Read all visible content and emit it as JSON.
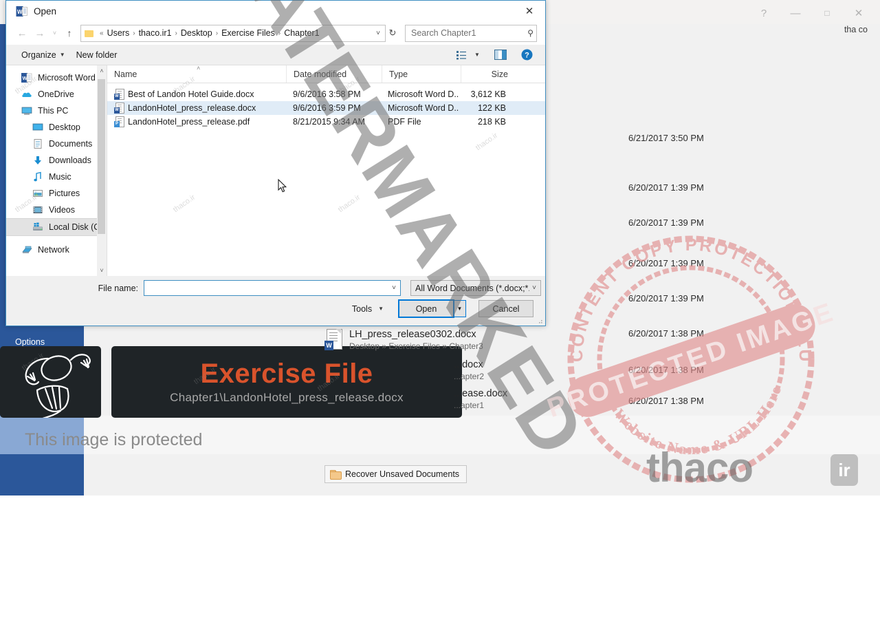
{
  "word_app": {
    "account_name": "tha co",
    "window_buttons": [
      {
        "name": "help",
        "glyph": "?"
      },
      {
        "name": "minimize",
        "glyph": "—"
      },
      {
        "name": "restore",
        "glyph": "□"
      },
      {
        "name": "close",
        "glyph": "✕"
      }
    ],
    "options_label": "Options",
    "exercise_banner": {
      "title": "Exercise File",
      "subtitle": "Chapter1\\LandonHotel_press_release.docx"
    },
    "protected_message": "This image is protected",
    "recover_button": "Recover Unsaved Documents",
    "recent_documents": [
      {
        "name": "LH_press_release0302.docx",
        "path": "Desktop » Exercise Files » Chapter3",
        "date": "6/21/2017 3:50 PM"
      },
      {
        "name": "...docx",
        "path": "...apter2",
        "date": "6/20/2017 1:39 PM"
      },
      {
        "name": "...ease.docx",
        "path": "...apter1",
        "date": "6/20/2017 1:39 PM"
      }
    ],
    "recent_dates": [
      "6/21/2017 3:50 PM",
      "6/20/2017 1:39 PM",
      "6/20/2017 1:39 PM",
      "6/20/2017 1:39 PM",
      "6/20/2017 1:39 PM",
      "6/20/2017 1:38 PM",
      "6/20/2017 1:38 PM",
      "6/20/2017 1:38 PM"
    ]
  },
  "dialog": {
    "title": "Open",
    "close_glyph": "✕",
    "nav": {
      "back_glyph": "←",
      "forward_glyph": "→",
      "history_glyph": "˅",
      "up_glyph": "↑",
      "refresh_glyph": "↻",
      "dropdown_glyph": "˅"
    },
    "breadcrumb": {
      "prefix": "«",
      "items": [
        "Users",
        "thaco.ir1",
        "Desktop",
        "Exercise Files",
        "Chapter1"
      ],
      "separator": "›"
    },
    "search": {
      "placeholder": "Search Chapter1",
      "icon": "search-icon",
      "glyph": "⚲"
    },
    "toolbar": {
      "organize": "Organize",
      "new_folder": "New folder",
      "caret": "▼",
      "view_icon": "view-list-icon",
      "preview_icon": "preview-pane-icon",
      "help_icon": "help-icon",
      "help_glyph": "?"
    },
    "nav_pane": {
      "items": [
        {
          "label": "Microsoft Word",
          "icon": "word-icon",
          "indent": false,
          "selected": false
        },
        {
          "label": "OneDrive",
          "icon": "onedrive-cloud-icon",
          "indent": false,
          "selected": false
        },
        {
          "label": "This PC",
          "icon": "this-pc-icon",
          "indent": false,
          "selected": false
        },
        {
          "label": "Desktop",
          "icon": "desktop-icon",
          "indent": true,
          "selected": false
        },
        {
          "label": "Documents",
          "icon": "documents-icon",
          "indent": true,
          "selected": false
        },
        {
          "label": "Downloads",
          "icon": "downloads-icon",
          "indent": true,
          "selected": false
        },
        {
          "label": "Music",
          "icon": "music-note-icon",
          "indent": true,
          "selected": false
        },
        {
          "label": "Pictures",
          "icon": "pictures-icon",
          "indent": true,
          "selected": false
        },
        {
          "label": "Videos",
          "icon": "videos-icon",
          "indent": true,
          "selected": false
        },
        {
          "label": "Local Disk (C:)",
          "icon": "hard-drive-icon",
          "indent": true,
          "selected": true
        },
        {
          "label": "Network",
          "icon": "network-icon",
          "indent": false,
          "selected": false
        }
      ],
      "scroll_up_glyph": "˄",
      "scroll_down_glyph": "˅"
    },
    "file_list": {
      "columns": [
        "Name",
        "Date modified",
        "Type",
        "Size"
      ],
      "sort_marker": "˄",
      "rows": [
        {
          "name": "Best of Landon Hotel Guide.docx",
          "date": "9/6/2016 3:58 PM",
          "type": "Microsoft Word D...",
          "size": "3,612 KB",
          "kind": "word",
          "selected": false
        },
        {
          "name": "LandonHotel_press_release.docx",
          "date": "9/6/2016 3:59 PM",
          "type": "Microsoft Word D...",
          "size": "122 KB",
          "kind": "word",
          "selected": true
        },
        {
          "name": "LandonHotel_press_release.pdf",
          "date": "8/21/2015 9:34 AM",
          "type": "PDF File",
          "size": "218 KB",
          "kind": "pdf",
          "selected": false
        }
      ]
    },
    "bottom": {
      "filename_label": "File name:",
      "filename_value": "",
      "filename_caret": "˅",
      "filetype_value": "All Word Documents (*.docx;*.d",
      "filetype_caret": "˅",
      "tools_label": "Tools",
      "tools_caret": "▼",
      "open_label": "Open",
      "open_split_caret": "▼",
      "cancel_label": "Cancel"
    }
  },
  "watermarks": {
    "diagonal": "WATERMARKED",
    "stamp_outer_top": "WP CONTENT COPY PROTECTION PLUGIN",
    "stamp_outer_bottom": "My Website Name & URL Here",
    "stamp_center": "PROTECTED IMAGE",
    "site": "thaco",
    "tld": "ir",
    "tile": "thaco.ir",
    "colors": {
      "stamp": "#e08a8a",
      "diagonal": "#8f8f8f",
      "word_blue": "#2b579a",
      "accent_orange": "#d9532c"
    }
  }
}
